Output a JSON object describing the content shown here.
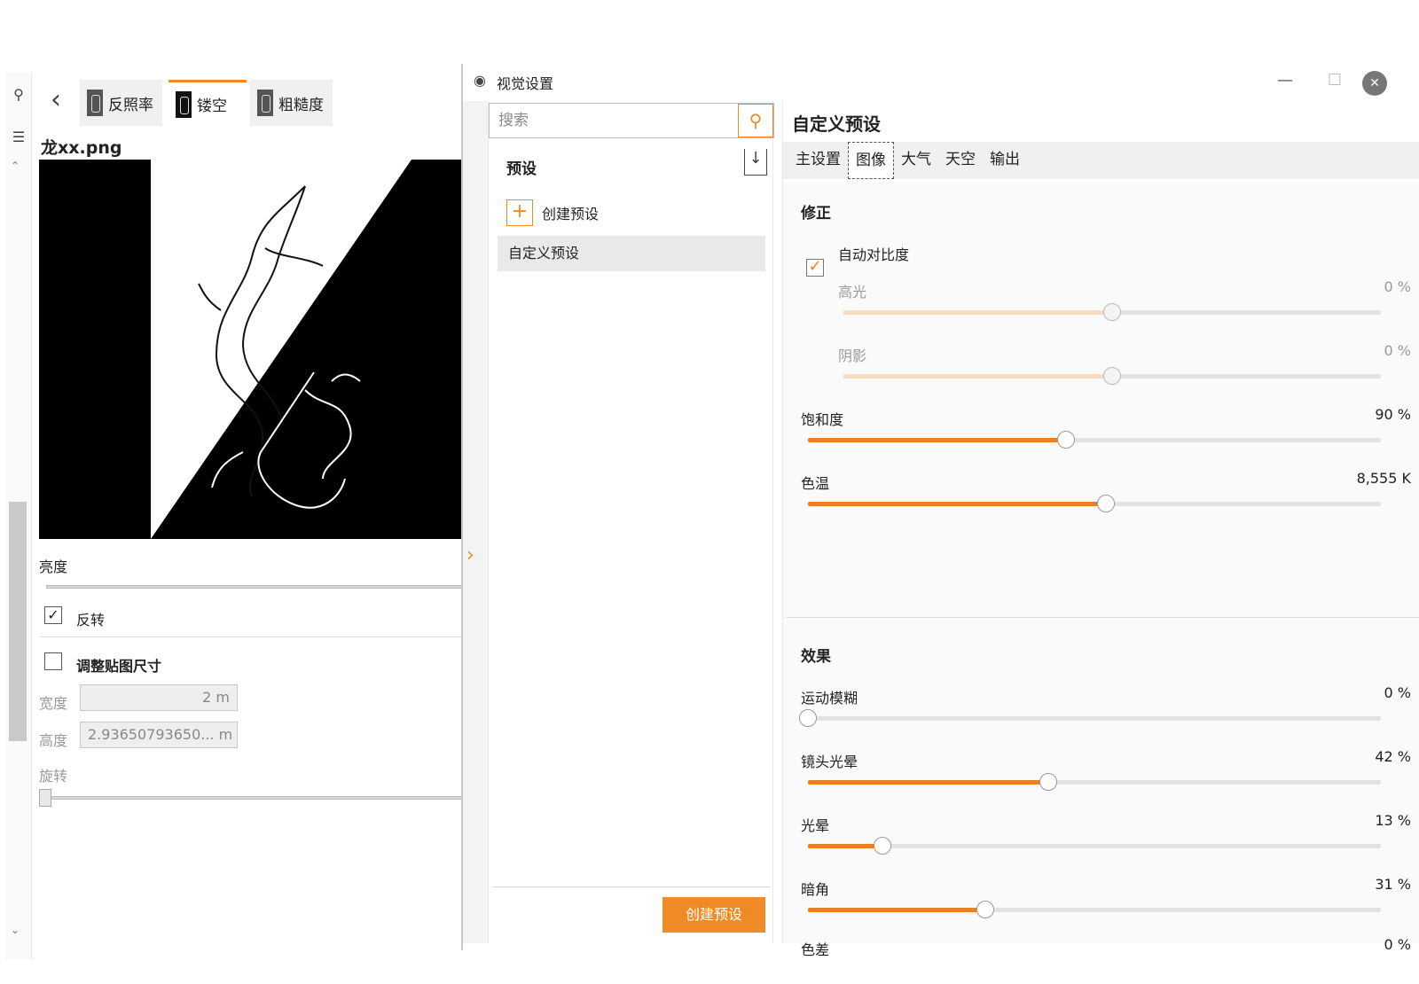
{
  "left_panel": {
    "material_tabs": [
      {
        "label": "反照率",
        "active": false
      },
      {
        "label": "镂空",
        "active": true
      },
      {
        "label": "粗糙度",
        "active": false
      }
    ],
    "file_name": "龙xx.png",
    "brightness_label": "亮度",
    "invert": {
      "label": "反转",
      "checked": true
    },
    "resize": {
      "label": "调整贴图尺寸",
      "checked": false
    },
    "width": {
      "label": "宽度",
      "value": "2 m"
    },
    "height": {
      "label": "高度",
      "value": "2.93650793650... m"
    },
    "rotate_label": "旋转"
  },
  "view_settings": {
    "window_title": "视觉设置",
    "search": {
      "placeholder": "搜索"
    },
    "presets_heading": "预设",
    "create_preset_row_label": "创建预设",
    "preset_items": [
      "自定义预设"
    ],
    "create_preset_button": "创建预设",
    "panel_title": "自定义预设",
    "tabs": [
      {
        "label": "主设置",
        "active": false
      },
      {
        "label": "图像",
        "active": true
      },
      {
        "label": "大气",
        "active": false
      },
      {
        "label": "天空",
        "active": false
      },
      {
        "label": "输出",
        "active": false
      }
    ],
    "correction": {
      "title": "修正",
      "auto_contrast": {
        "label": "自动对比度",
        "checked": true
      },
      "highlight": {
        "label": "高光",
        "value": "0 %",
        "level": 0.5
      },
      "shadow": {
        "label": "阴影",
        "value": "0 %",
        "level": 0.5
      },
      "saturation": {
        "label": "饱和度",
        "value": "90 %",
        "level": 0.45
      },
      "color_temp": {
        "label": "色温",
        "value": "8,555 K",
        "level": 0.52
      }
    },
    "effects": {
      "title": "效果",
      "motion_blur": {
        "label": "运动模糊",
        "value": "0 %",
        "level": 0.0
      },
      "lens_flare": {
        "label": "镜头光晕",
        "value": "42 %",
        "level": 0.42
      },
      "glow": {
        "label": "光晕",
        "value": "13 %",
        "level": 0.13
      },
      "vignette": {
        "label": "暗角",
        "value": "31 %",
        "level": 0.31
      },
      "chromatic": {
        "label": "色差",
        "value": "0 %",
        "level": 0.0
      }
    }
  },
  "colors": {
    "accent": "#e8801f",
    "accent_pale": "#f7dcc1"
  }
}
